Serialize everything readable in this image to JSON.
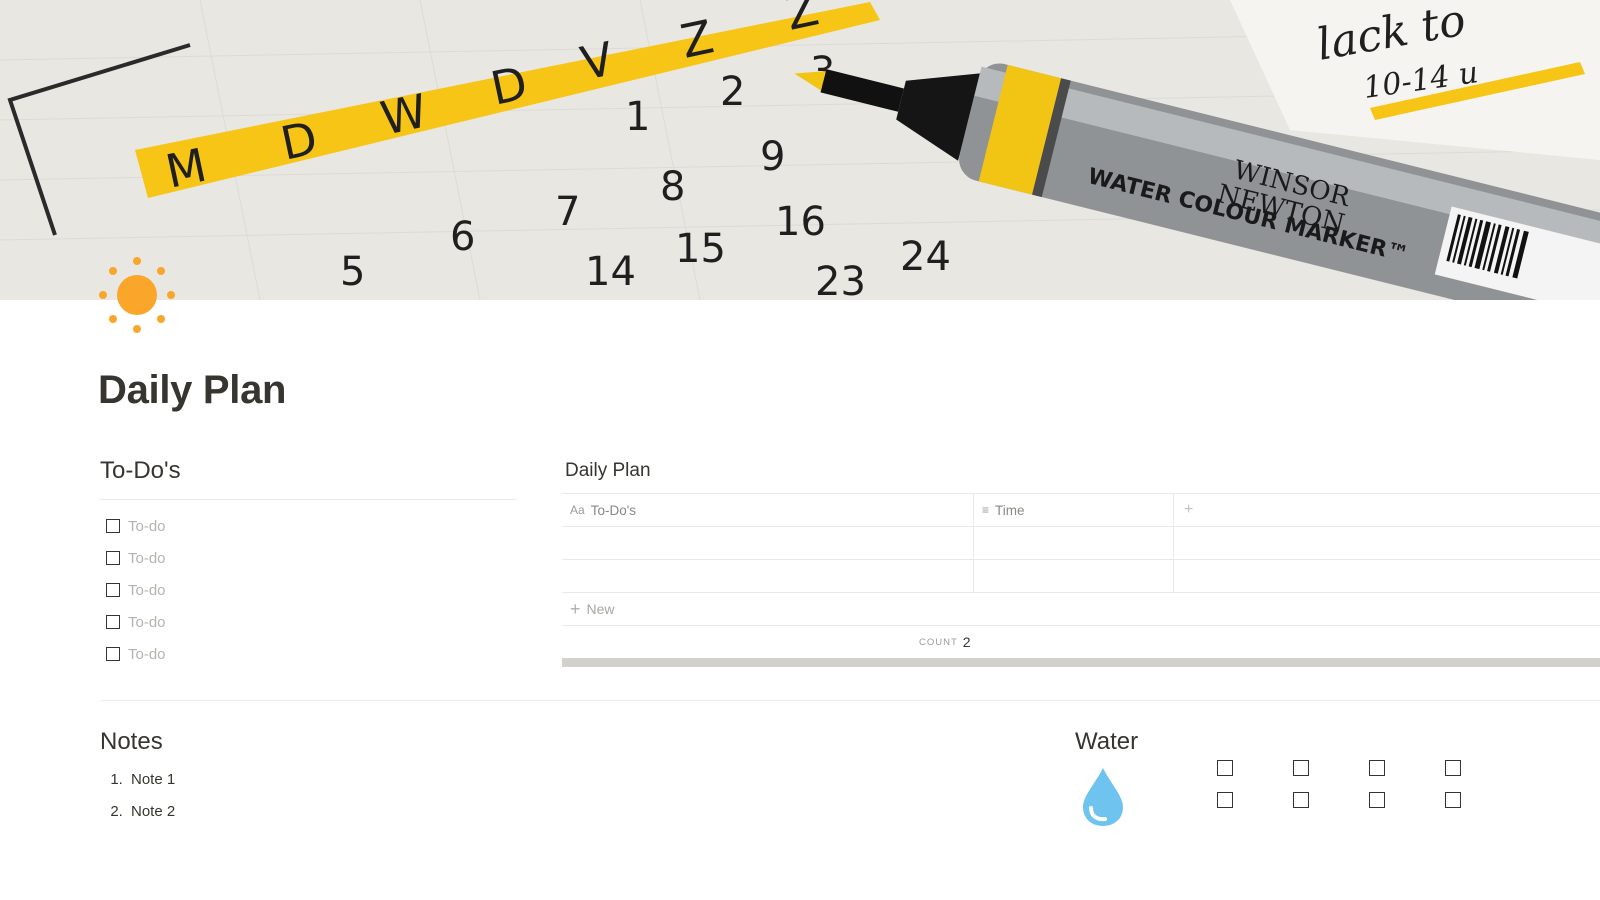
{
  "page": {
    "title": "Daily Plan",
    "icon": "sun-icon",
    "cover": "calendar-marker-photo"
  },
  "todos": {
    "heading": "To-Do's",
    "items": [
      {
        "text": "To-do",
        "checked": false
      },
      {
        "text": "To-do",
        "checked": false
      },
      {
        "text": "To-do",
        "checked": false
      },
      {
        "text": "To-do",
        "checked": false
      },
      {
        "text": "To-do",
        "checked": false
      }
    ]
  },
  "database": {
    "title": "Daily Plan",
    "columns": [
      {
        "label": "To-Do's",
        "icon": "title-property-icon"
      },
      {
        "label": "Time",
        "icon": "text-property-icon"
      }
    ],
    "rows": [
      {
        "todo": "",
        "time": ""
      },
      {
        "todo": "",
        "time": ""
      }
    ],
    "new_label": "New",
    "count_label": "COUNT",
    "count_value": "2"
  },
  "notes": {
    "heading": "Notes",
    "items": [
      "Note 1",
      "Note 2"
    ]
  },
  "water": {
    "heading": "Water",
    "icon": "water-drop-icon",
    "checkboxes": [
      false,
      false,
      false,
      false,
      false,
      false,
      false,
      false
    ]
  },
  "colors": {
    "text": "#37352f",
    "muted": "#9b9a97",
    "placeholder": "#b5b3ae",
    "sun": "#f9a62b",
    "drop": "#6fc3ef",
    "marker_yellow": "#f6c516"
  }
}
